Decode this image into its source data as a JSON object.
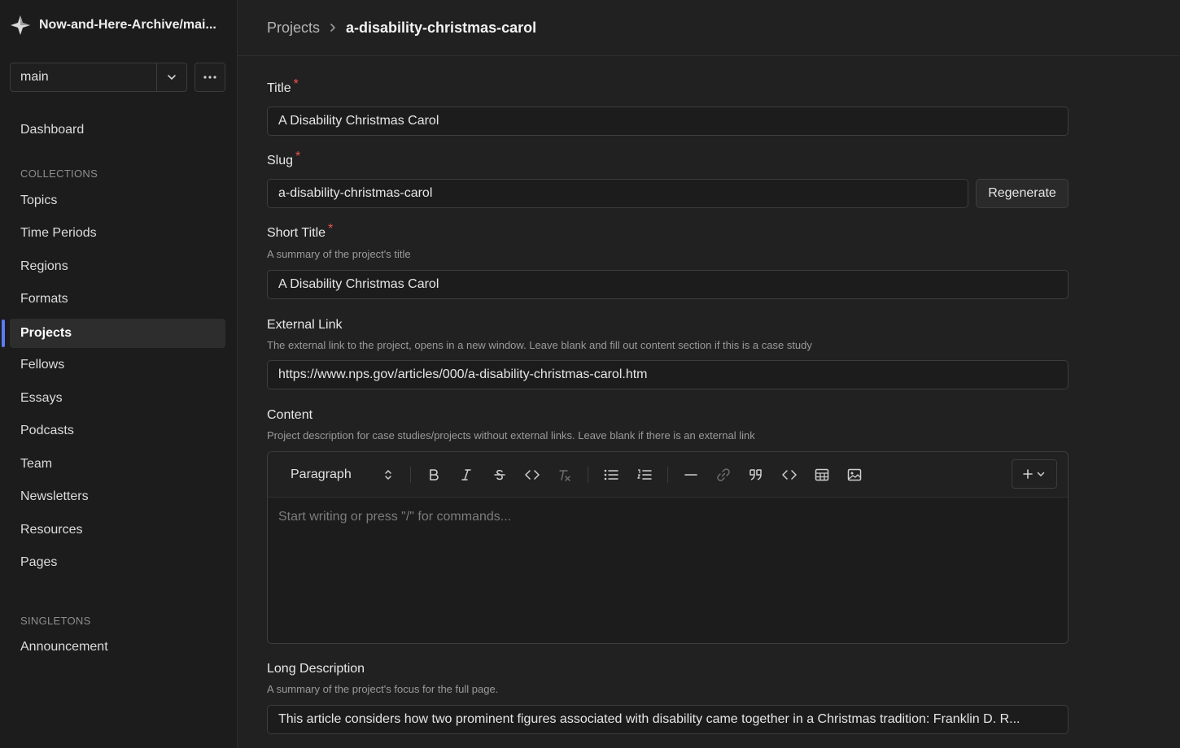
{
  "sidebar": {
    "repo_title": "Now-and-Here-Archive/mai...",
    "branch": "main",
    "dashboard_label": "Dashboard",
    "collections_heading": "COLLECTIONS",
    "collections": [
      "Topics",
      "Time Periods",
      "Regions",
      "Formats",
      "Projects",
      "Fellows",
      "Essays",
      "Podcasts",
      "Team",
      "Newsletters",
      "Resources",
      "Pages"
    ],
    "active_item": "Projects",
    "singletons_heading": "SINGLETONS",
    "singletons": [
      "Announcement"
    ]
  },
  "breadcrumb": {
    "parent": "Projects",
    "current": "a-disability-christmas-carol"
  },
  "form": {
    "title": {
      "label": "Title",
      "value": "A Disability Christmas Carol",
      "required": "*"
    },
    "slug": {
      "label": "Slug",
      "value": "a-disability-christmas-carol",
      "required": "*",
      "regenerate_label": "Regenerate"
    },
    "short_title": {
      "label": "Short Title",
      "required": "*",
      "description": "A summary of the project's title",
      "value": "A Disability Christmas Carol"
    },
    "external_link": {
      "label": "External Link",
      "description": "The external link to the project, opens in a new window. Leave blank and fill out content section if this is a case study",
      "value": "https://www.nps.gov/articles/000/a-disability-christmas-carol.htm"
    },
    "content": {
      "label": "Content",
      "description": "Project description for case studies/projects without external links. Leave blank if there is an external link",
      "block_type": "Paragraph",
      "placeholder": "Start writing or press \"/\" for commands..."
    },
    "long_description": {
      "label": "Long Description",
      "description": "A summary of the project's focus for the full page.",
      "value": "This article considers how two prominent figures associated with disability came together in a Christmas tradition: Franklin D. R..."
    }
  },
  "colors": {
    "accent": "#5b7cf7",
    "required": "#f0524f",
    "background": "#212121",
    "sidebar": "#1c1c1c"
  }
}
